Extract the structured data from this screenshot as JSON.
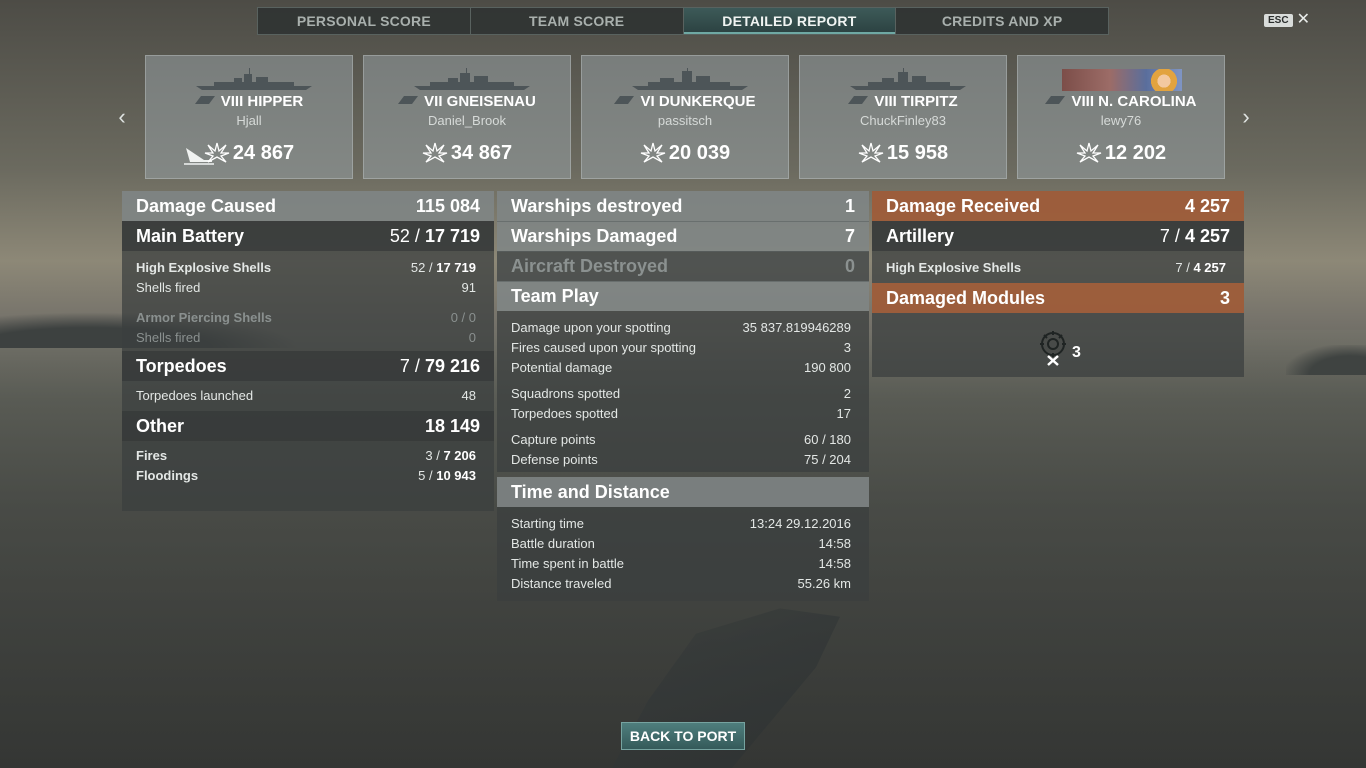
{
  "tabs": [
    {
      "label": "PERSONAL SCORE"
    },
    {
      "label": "TEAM SCORE"
    },
    {
      "label": "DETAILED REPORT"
    },
    {
      "label": "CREDITS AND XP"
    }
  ],
  "esc": {
    "key": "ESC",
    "close": "✕"
  },
  "nav": {
    "prev": "‹",
    "next": "›"
  },
  "cards": [
    {
      "name": "VIII HIPPER",
      "player": "Hjall",
      "damage": "24 867"
    },
    {
      "name": "VII GNEISENAU",
      "player": "Daniel_Brook",
      "damage": "34 867"
    },
    {
      "name": "VI DUNKERQUE",
      "player": "passitsch",
      "damage": "20 039"
    },
    {
      "name": "VIII TIRPITZ",
      "player": "ChuckFinley83",
      "damage": "15 958"
    },
    {
      "name": "VIII N. CAROLINA",
      "player": "lewy76",
      "damage": "12 202"
    }
  ],
  "damage_caused": {
    "title": "Damage Caused",
    "total": "115 084",
    "main_battery": {
      "label": "Main Battery",
      "hits": "52 /",
      "value": "17 719"
    },
    "he_shells": {
      "label": "High Explosive Shells",
      "hits": "52 /",
      "value": "17 719"
    },
    "he_fired": {
      "label": "Shells fired",
      "value": "91"
    },
    "ap_shells": {
      "label": "Armor Piercing Shells",
      "value": "0 / 0"
    },
    "ap_fired": {
      "label": "Shells fired",
      "value": "0"
    },
    "torpedoes": {
      "label": "Torpedoes",
      "hits": "7 /",
      "value": "79 216"
    },
    "torp_launched": {
      "label": "Torpedoes launched",
      "value": "48"
    },
    "other": {
      "label": "Other",
      "value": "18 149"
    },
    "fires": {
      "label": "Fires",
      "hits": "3 /",
      "value": "7 206"
    },
    "floodings": {
      "label": "Floodings",
      "hits": "5 /",
      "value": "10 943"
    }
  },
  "middle": {
    "warships_destroyed": {
      "label": "Warships destroyed",
      "value": "1"
    },
    "warships_damaged": {
      "label": "Warships Damaged",
      "value": "7"
    },
    "aircraft_destroyed": {
      "label": "Aircraft Destroyed",
      "value": "0"
    },
    "team_play": {
      "title": "Team Play",
      "rows": [
        {
          "label": "Damage upon your spotting",
          "value": "35 837.819946289"
        },
        {
          "label": "Fires caused upon your spotting",
          "value": "3"
        },
        {
          "label": "Potential damage",
          "value": "190 800"
        },
        {
          "label": "Squadrons spotted",
          "value": "2"
        },
        {
          "label": "Torpedoes spotted",
          "value": "17"
        },
        {
          "label": "Capture points",
          "value": "60 / 180"
        },
        {
          "label": "Defense points",
          "value": "75 / 204"
        }
      ]
    },
    "time_distance": {
      "title": "Time and Distance",
      "rows": [
        {
          "label": "Starting time",
          "value": "13:24  29.12.2016"
        },
        {
          "label": "Battle duration",
          "value": "14:58"
        },
        {
          "label": "Time spent in battle",
          "value": "14:58"
        },
        {
          "label": "Distance traveled",
          "value": "55.26 km"
        }
      ]
    }
  },
  "damage_received": {
    "title": "Damage Received",
    "total": "4 257",
    "artillery": {
      "label": "Artillery",
      "hits": "7 /",
      "value": "4 257"
    },
    "he_shells": {
      "label": "High Explosive Shells",
      "hits": "7 /",
      "value": "4 257"
    },
    "modules": {
      "title": "Damaged Modules",
      "value": "3",
      "icon_count": "3"
    }
  },
  "back_button": "BACK TO PORT",
  "colors": {
    "accent": "#6fa9a4",
    "received": "#aa603a"
  }
}
